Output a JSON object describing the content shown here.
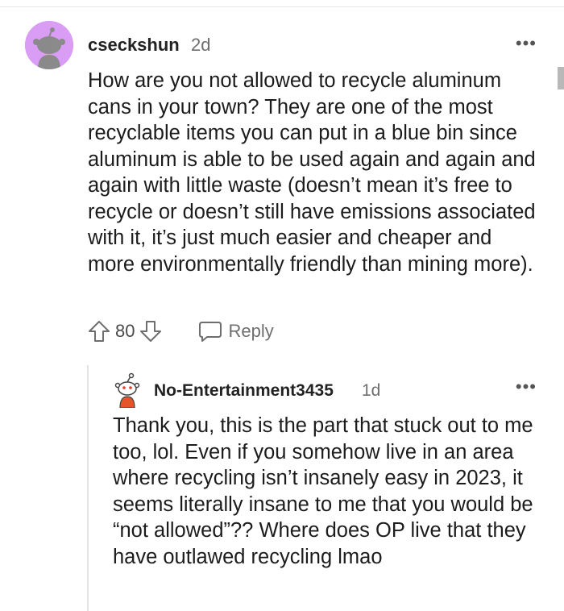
{
  "comment": {
    "username": "cseckshun",
    "time": "2d",
    "body": "How are you not allowed to recycle aluminum cans in your town? They are one of the most recyclable items you can put in a blue bin since aluminum is able to be used again and again and again with little waste (doesn’t mean it’s free to recycle or doesn’t still have emissions associated with it, it’s just much easier and cheaper and more environmentally friendly than mining more).",
    "score": "80",
    "reply_label": "Reply",
    "avatar_color": "#d99df5"
  },
  "reply": {
    "username": "No-Entertainment3435",
    "time": "1d",
    "body": "Thank you, this is the part that stuck out to me too, lol. Even if you somehow live in an area where recycling isn’t insanely easy in 2023, it seems literally insane to me that you would be “not allowed”?? Where does OP live that they have outlawed recycling lmao"
  },
  "icons": {
    "more": "more-options-icon",
    "upvote": "upvote-arrow-icon",
    "downvote": "downvote-arrow-icon",
    "reply": "speech-bubble-icon",
    "avatar": "snoo-avatar-icon"
  }
}
